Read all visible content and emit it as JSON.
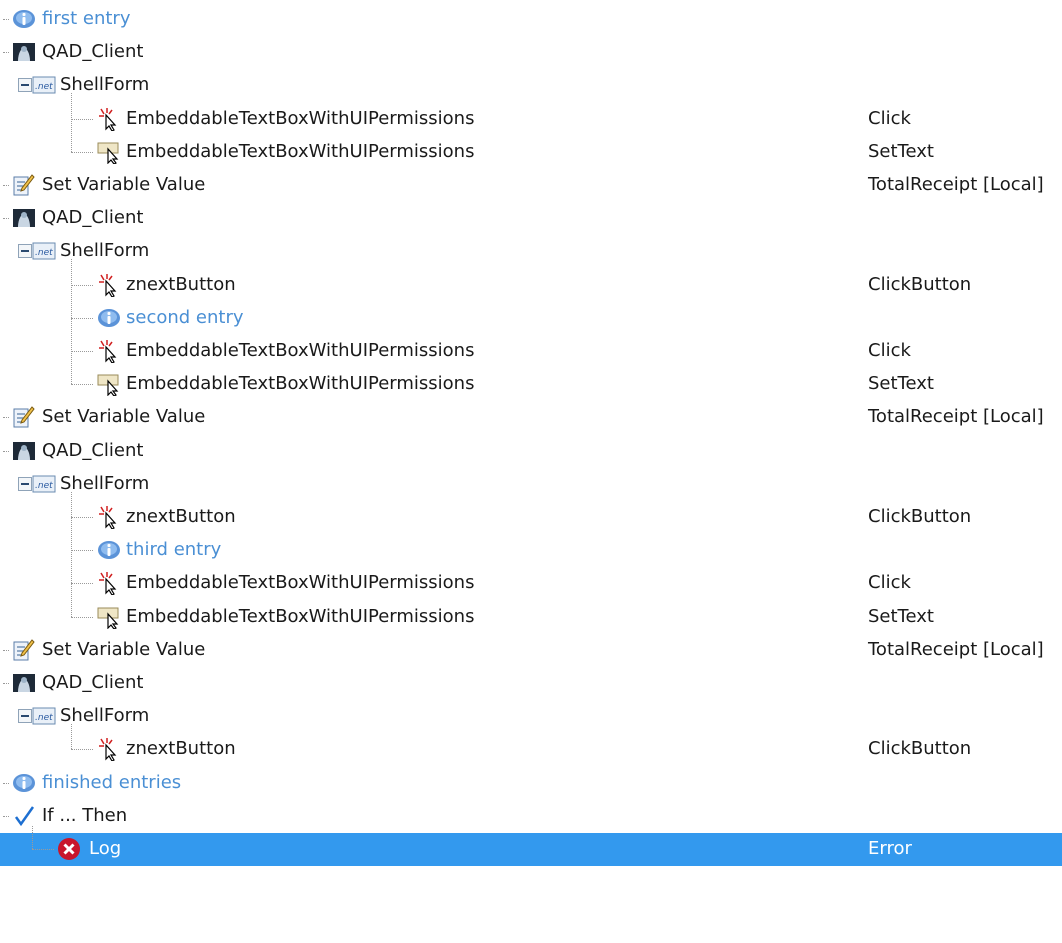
{
  "rows": [
    {
      "type": "comment",
      "level": 0,
      "label": "first entry",
      "value": ""
    },
    {
      "type": "app",
      "level": 0,
      "label": "QAD_Client",
      "value": ""
    },
    {
      "type": "form",
      "level": 1,
      "label": "ShellForm",
      "value": ""
    },
    {
      "type": "click",
      "level": 2,
      "label": "EmbeddableTextBoxWithUIPermissions",
      "value": "Click"
    },
    {
      "type": "settext",
      "level": 2,
      "label": "EmbeddableTextBoxWithUIPermissions",
      "value": "SetText",
      "last": true
    },
    {
      "type": "setvar",
      "level": 0,
      "label": "Set Variable Value",
      "value": "TotalReceipt [Local]"
    },
    {
      "type": "app",
      "level": 0,
      "label": "QAD_Client",
      "value": ""
    },
    {
      "type": "form",
      "level": 1,
      "label": "ShellForm",
      "value": ""
    },
    {
      "type": "click",
      "level": 2,
      "label": "znextButton",
      "value": "ClickButton"
    },
    {
      "type": "comment",
      "level": 2,
      "label": "second entry",
      "value": ""
    },
    {
      "type": "click",
      "level": 2,
      "label": "EmbeddableTextBoxWithUIPermissions",
      "value": "Click"
    },
    {
      "type": "settext",
      "level": 2,
      "label": "EmbeddableTextBoxWithUIPermissions",
      "value": "SetText",
      "last": true
    },
    {
      "type": "setvar",
      "level": 0,
      "label": "Set Variable Value",
      "value": "TotalReceipt [Local]"
    },
    {
      "type": "app",
      "level": 0,
      "label": "QAD_Client",
      "value": ""
    },
    {
      "type": "form",
      "level": 1,
      "label": "ShellForm",
      "value": ""
    },
    {
      "type": "click",
      "level": 2,
      "label": "znextButton",
      "value": "ClickButton"
    },
    {
      "type": "comment",
      "level": 2,
      "label": "third entry",
      "value": ""
    },
    {
      "type": "click",
      "level": 2,
      "label": "EmbeddableTextBoxWithUIPermissions",
      "value": "Click"
    },
    {
      "type": "settext",
      "level": 2,
      "label": "EmbeddableTextBoxWithUIPermissions",
      "value": "SetText",
      "last": true
    },
    {
      "type": "setvar",
      "level": 0,
      "label": "Set Variable Value",
      "value": "TotalReceipt [Local]"
    },
    {
      "type": "app",
      "level": 0,
      "label": "QAD_Client",
      "value": ""
    },
    {
      "type": "form",
      "level": 1,
      "label": "ShellForm",
      "value": ""
    },
    {
      "type": "click",
      "level": 2,
      "label": "znextButton",
      "value": "ClickButton",
      "last": true
    },
    {
      "type": "comment",
      "level": 0,
      "label": "finished entries",
      "value": ""
    },
    {
      "type": "ifthen",
      "level": 0,
      "label": "If ... Then",
      "value": ""
    },
    {
      "type": "error",
      "level": 1,
      "label": "Log",
      "value": "Error",
      "selected": true,
      "last": true
    }
  ],
  "icons": {
    "comment": "info-icon",
    "app": "application-icon",
    "form": "dotnet-form-icon",
    "click": "mouse-click-icon",
    "settext": "set-text-icon",
    "setvar": "set-variable-icon",
    "ifthen": "checkmark-icon",
    "error": "error-icon"
  },
  "colors": {
    "selection": "#3399ee",
    "comment_text": "#4a8fd4",
    "text": "#1a1a1a"
  }
}
